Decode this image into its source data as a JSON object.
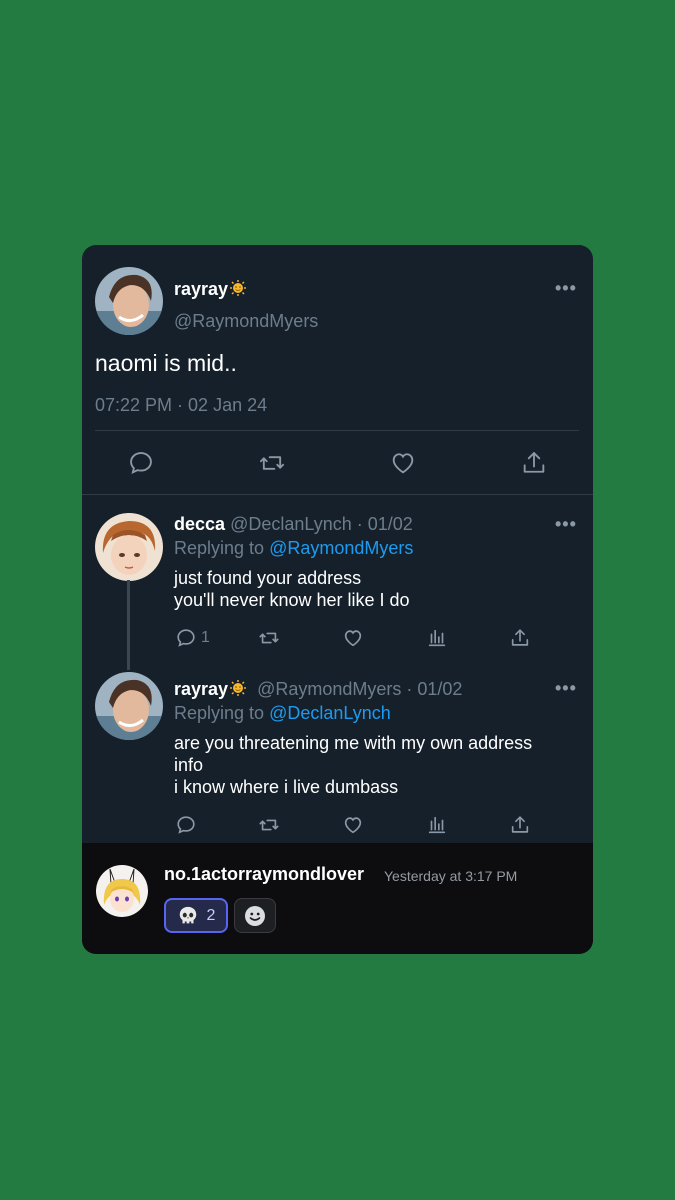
{
  "main_tweet": {
    "display_name": "rayray",
    "handle": "@RaymondMyers",
    "text": "naomi is mid..",
    "timestamp": "07:22 PM · 02 Jan 24",
    "more": "•••"
  },
  "reply1": {
    "display_name": "decca",
    "handle_date": "@DeclanLynch · 01/02",
    "replying_prefix": "Replying to",
    "replying_to": "@RaymondMyers",
    "line1": "just found your address",
    "line2": "you'll never know her like I do",
    "reply_count": "1",
    "more": "•••"
  },
  "reply2": {
    "display_name": "rayray",
    "handle_date": "@RaymondMyers · 01/02",
    "replying_prefix": "Replying to",
    "replying_to": "@DeclanLynch",
    "line1": "are you threatening me with my own address",
    "line2": "info",
    "line3": "i know where i live dumbass",
    "more": "•••"
  },
  "discord": {
    "username": "no.1actorraymondlover",
    "timestamp": "Yesterday at 3:17 PM",
    "reaction_emoji": "skull-emoji",
    "reaction_count": "2",
    "add_reaction_icon": "add-reaction-icon"
  },
  "colors": {
    "background": "#237b42",
    "card": "#15202b",
    "link": "#1d9bf0",
    "reaction_border": "#5865f2"
  }
}
